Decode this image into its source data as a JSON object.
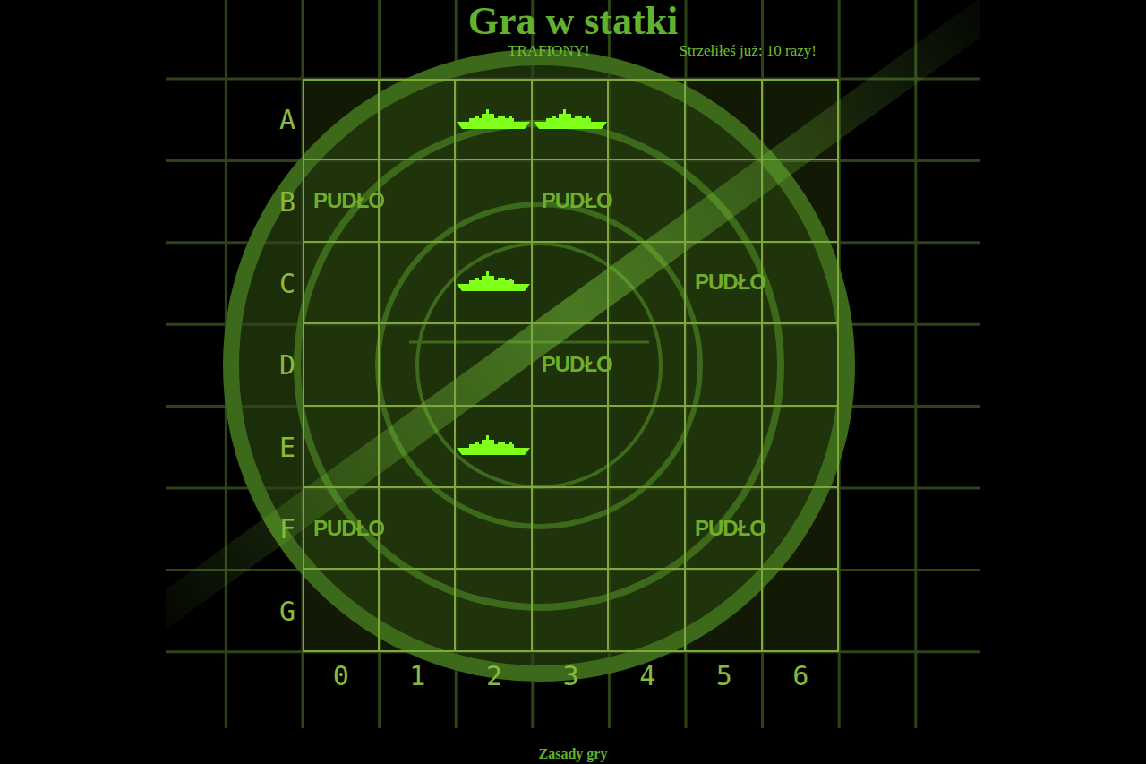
{
  "title": "Gra w statki",
  "messages": {
    "status": "TRAFIONY!",
    "shots": "Strzełiłeś już: 10 razy!"
  },
  "board": {
    "columns": [
      "0",
      "1",
      "2",
      "3",
      "4",
      "5",
      "6"
    ],
    "rows": [
      {
        "label": "A",
        "cells": [
          {
            "kind": "empty"
          },
          {
            "kind": "empty"
          },
          {
            "kind": "hit"
          },
          {
            "kind": "hit"
          },
          {
            "kind": "empty"
          },
          {
            "kind": "empty"
          },
          {
            "kind": "empty"
          }
        ]
      },
      {
        "label": "B",
        "cells": [
          {
            "kind": "miss",
            "text": "PUDŁO"
          },
          {
            "kind": "empty"
          },
          {
            "kind": "empty"
          },
          {
            "kind": "miss",
            "text": "PUDŁO"
          },
          {
            "kind": "empty"
          },
          {
            "kind": "empty"
          },
          {
            "kind": "empty"
          }
        ]
      },
      {
        "label": "C",
        "cells": [
          {
            "kind": "empty"
          },
          {
            "kind": "empty"
          },
          {
            "kind": "hit"
          },
          {
            "kind": "empty"
          },
          {
            "kind": "empty"
          },
          {
            "kind": "miss",
            "text": "PUDŁO"
          },
          {
            "kind": "empty"
          }
        ]
      },
      {
        "label": "D",
        "cells": [
          {
            "kind": "empty"
          },
          {
            "kind": "empty"
          },
          {
            "kind": "empty"
          },
          {
            "kind": "miss",
            "text": "PUDŁO"
          },
          {
            "kind": "empty"
          },
          {
            "kind": "empty"
          },
          {
            "kind": "empty"
          }
        ]
      },
      {
        "label": "E",
        "cells": [
          {
            "kind": "empty"
          },
          {
            "kind": "empty"
          },
          {
            "kind": "hit"
          },
          {
            "kind": "empty"
          },
          {
            "kind": "empty"
          },
          {
            "kind": "empty"
          },
          {
            "kind": "empty"
          }
        ]
      },
      {
        "label": "F",
        "cells": [
          {
            "kind": "miss",
            "text": "PUDŁO"
          },
          {
            "kind": "empty"
          },
          {
            "kind": "empty"
          },
          {
            "kind": "empty"
          },
          {
            "kind": "empty"
          },
          {
            "kind": "miss",
            "text": "PUDŁO"
          },
          {
            "kind": "empty"
          }
        ]
      },
      {
        "label": "G",
        "cells": [
          {
            "kind": "empty"
          },
          {
            "kind": "empty"
          },
          {
            "kind": "empty"
          },
          {
            "kind": "empty"
          },
          {
            "kind": "empty"
          },
          {
            "kind": "empty"
          },
          {
            "kind": "empty"
          }
        ]
      }
    ]
  },
  "footer": {
    "link": "Zasady gry"
  }
}
